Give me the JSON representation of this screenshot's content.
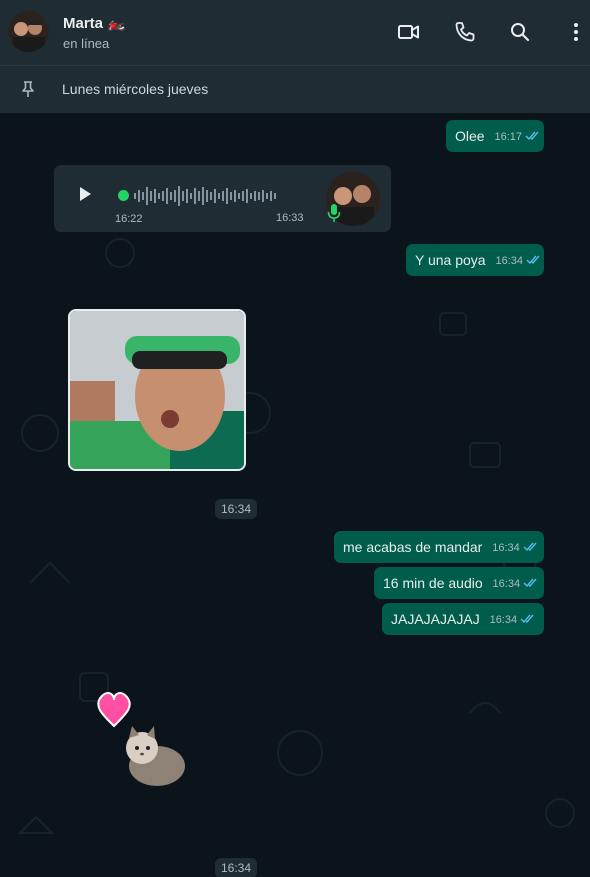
{
  "header": {
    "contact_name": "Marta 🏍️",
    "status": "en línea",
    "icons": [
      "video-call-icon",
      "voice-call-icon",
      "search-icon",
      "more-options-icon"
    ]
  },
  "pinned": {
    "text": "Lunes miércoles jueves"
  },
  "messages": [
    {
      "text": "Olee",
      "time": "16:17"
    },
    {
      "text": "Y una poya",
      "time": "16:34"
    },
    {
      "text": "me acabas de mandar",
      "time": "16:34"
    },
    {
      "text": "16 min de audio",
      "time": "16:34"
    },
    {
      "text": "JAJAJAJAJAJ",
      "time": "16:34"
    }
  ],
  "audio": {
    "start_time": "16:22",
    "sent_time": "16:33"
  },
  "image_message_time": "16:34",
  "sticker_time": "16:34",
  "colors": {
    "outgoing_bubble": "#005c4b",
    "incoming_bubble": "#1f2c34",
    "header": "#1f2c34",
    "accent": "#25d366",
    "read_tick": "#53bdeb"
  }
}
